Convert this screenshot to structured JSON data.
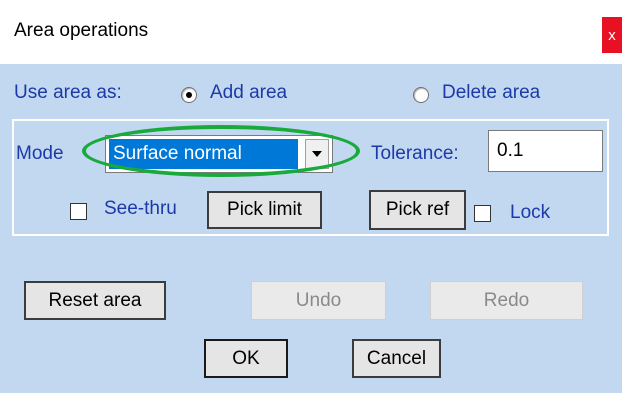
{
  "window": {
    "title": "Area operations",
    "close_label": "x"
  },
  "use_area": {
    "label": "Use area as:",
    "options": [
      {
        "label": "Add area",
        "selected": true
      },
      {
        "label": "Delete area",
        "selected": false
      }
    ]
  },
  "mode": {
    "label": "Mode",
    "selected_value": "Surface normal"
  },
  "tolerance": {
    "label": "Tolerance:",
    "value": "0.1"
  },
  "see_thru": {
    "label": "See-thru",
    "checked": false
  },
  "lock": {
    "label": "Lock",
    "checked": false
  },
  "buttons": {
    "pick_limit": "Pick limit",
    "pick_ref": "Pick ref",
    "reset_area": "Reset area",
    "undo": "Undo",
    "redo": "Redo",
    "ok": "OK",
    "cancel": "Cancel"
  },
  "colors": {
    "client_bg": "#c2d8f0",
    "label_text": "#1b3aa8",
    "selection": "#0078d7",
    "highlight_ring": "#1aaa3c",
    "close_button": "#e81123"
  },
  "icons": {
    "dropdown": "chevron-down-icon",
    "close": "close-icon"
  }
}
